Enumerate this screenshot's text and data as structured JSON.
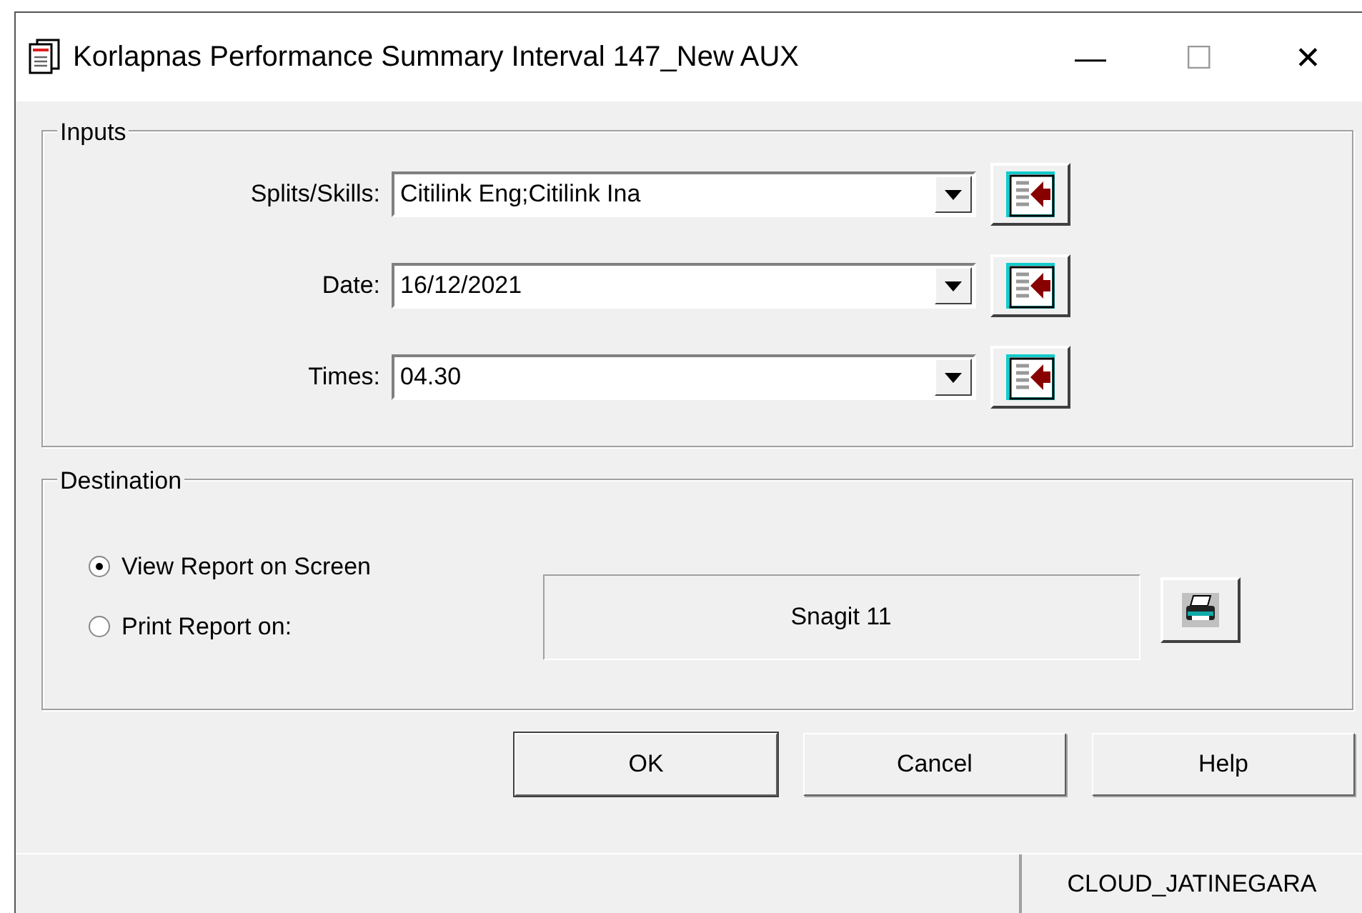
{
  "window": {
    "title": "Korlapnas Performance Summary Interval 147_New AUX",
    "controls": [
      "—",
      "☐",
      "✕"
    ]
  },
  "inputs": {
    "legend": "Inputs",
    "fields": [
      {
        "label": "Splits/Skills:",
        "value": "Citilink Eng;Citilink Ina"
      },
      {
        "label": "Date:",
        "value": "16/12/2021"
      },
      {
        "label": "Times:",
        "value": "04.30"
      }
    ]
  },
  "destination": {
    "legend": "Destination",
    "options": [
      {
        "label": "View Report on Screen",
        "selected": true
      },
      {
        "label": "Print Report on:",
        "selected": false
      }
    ],
    "printer": "Snagit 11"
  },
  "buttons": [
    {
      "label": "OK",
      "default": true
    },
    {
      "label": "Cancel",
      "default": false
    },
    {
      "label": "Help",
      "default": false
    }
  ],
  "status_bar": {
    "server": "CLOUD_JATINEGARA"
  }
}
